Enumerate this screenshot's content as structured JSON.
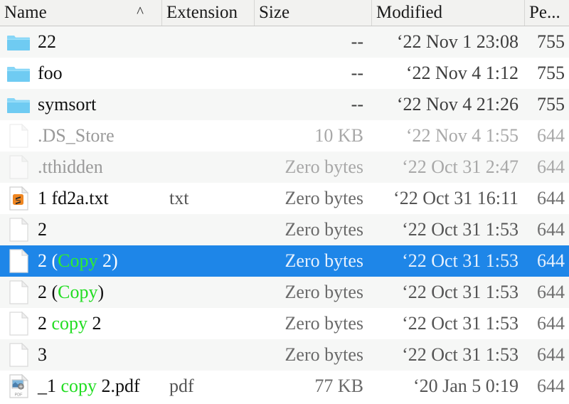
{
  "columns": [
    {
      "key": "name",
      "label": "Name",
      "sorted": true,
      "sort_glyph": "^"
    },
    {
      "key": "extension",
      "label": "Extension"
    },
    {
      "key": "size",
      "label": "Size"
    },
    {
      "key": "modified",
      "label": "Modified"
    },
    {
      "key": "permissions",
      "label": "Pe..."
    }
  ],
  "colors": {
    "selection": "#1e86e8",
    "match_highlight": "#22dd22",
    "header_bg": "#f2f2f0",
    "row_alt_bg": "#f6f7f6",
    "folder_icon": "#74cdf2"
  },
  "rows": [
    {
      "icon": "folder-icon",
      "name_parts": [
        {
          "text": "22",
          "match": false
        }
      ],
      "extension": "",
      "size": "--",
      "modified": "‘22 Nov 1 23:08",
      "permissions": "755",
      "type": "folder",
      "selected": false,
      "dim": false
    },
    {
      "icon": "folder-icon",
      "name_parts": [
        {
          "text": "foo",
          "match": false
        }
      ],
      "extension": "",
      "size": "--",
      "modified": "‘22 Nov 4 1:12",
      "permissions": "755",
      "type": "folder",
      "selected": false,
      "dim": false
    },
    {
      "icon": "folder-icon",
      "name_parts": [
        {
          "text": "symsort",
          "match": false
        }
      ],
      "extension": "",
      "size": "--",
      "modified": "‘22 Nov 4 21:26",
      "permissions": "755",
      "type": "folder",
      "selected": false,
      "dim": false
    },
    {
      "icon": "file-icon",
      "name_parts": [
        {
          "text": ".DS_Store",
          "match": false
        }
      ],
      "extension": "",
      "size": "10 KB",
      "modified": "‘22 Nov 4 1:55",
      "permissions": "644",
      "type": "file",
      "selected": false,
      "dim": true
    },
    {
      "icon": "file-icon",
      "name_parts": [
        {
          "text": ".tthidden",
          "match": false
        }
      ],
      "extension": "",
      "size": "Zero bytes",
      "modified": "‘22 Oct 31 2:47",
      "permissions": "644",
      "type": "file",
      "selected": false,
      "dim": true
    },
    {
      "icon": "sublime-text-icon",
      "name_parts": [
        {
          "text": "1  fd2a.txt",
          "match": false
        }
      ],
      "extension": "txt",
      "size": "Zero bytes",
      "modified": "‘22 Oct 31 16:11",
      "permissions": "644",
      "type": "file",
      "selected": false,
      "dim": false
    },
    {
      "icon": "file-icon",
      "name_parts": [
        {
          "text": "2",
          "match": false
        }
      ],
      "extension": "",
      "size": "Zero bytes",
      "modified": "‘22 Oct 31 1:53",
      "permissions": "644",
      "type": "file",
      "selected": false,
      "dim": false
    },
    {
      "icon": "file-icon",
      "name_parts": [
        {
          "text": "2 (",
          "match": false
        },
        {
          "text": "Copy",
          "match": true
        },
        {
          "text": " 2)",
          "match": false
        }
      ],
      "extension": "",
      "size": "Zero bytes",
      "modified": "‘22 Oct 31 1:53",
      "permissions": "644",
      "type": "file",
      "selected": true,
      "dim": false
    },
    {
      "icon": "file-icon",
      "name_parts": [
        {
          "text": "2 (",
          "match": false
        },
        {
          "text": "Copy",
          "match": true
        },
        {
          "text": ")",
          "match": false
        }
      ],
      "extension": "",
      "size": "Zero bytes",
      "modified": "‘22 Oct 31 1:53",
      "permissions": "644",
      "type": "file",
      "selected": false,
      "dim": false
    },
    {
      "icon": "file-icon",
      "name_parts": [
        {
          "text": "2 ",
          "match": false
        },
        {
          "text": "copy",
          "match": true
        },
        {
          "text": " 2",
          "match": false
        }
      ],
      "extension": "",
      "size": "Zero bytes",
      "modified": "‘22 Oct 31 1:53",
      "permissions": "644",
      "type": "file",
      "selected": false,
      "dim": false
    },
    {
      "icon": "file-icon",
      "name_parts": [
        {
          "text": "3",
          "match": false
        }
      ],
      "extension": "",
      "size": "Zero bytes",
      "modified": "‘22 Oct 31 1:53",
      "permissions": "644",
      "type": "file",
      "selected": false,
      "dim": false
    },
    {
      "icon": "pdf-icon",
      "name_parts": [
        {
          "text": "_1 ",
          "match": false
        },
        {
          "text": "copy",
          "match": true
        },
        {
          "text": " 2.pdf",
          "match": false
        }
      ],
      "extension": "pdf",
      "size": "77 KB",
      "modified": "‘20 Jan 5 0:19",
      "permissions": "644",
      "type": "file",
      "selected": false,
      "dim": false
    }
  ]
}
